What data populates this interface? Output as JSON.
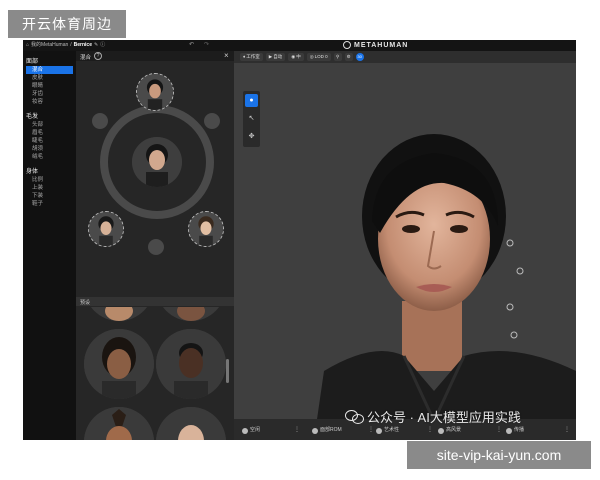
{
  "watermarks": {
    "top_left": "开云体育周边",
    "bottom_right": "site-vip-kai-yun.com",
    "wechat": "公众号 · AI大模型应用实践"
  },
  "titlebar": {
    "breadcrumb_home": "我的MetaHuman",
    "separator": "/",
    "breadcrumb_current": "Bernice",
    "brand": "METAHUMAN"
  },
  "nav": {
    "sections": [
      {
        "title": "面部",
        "items": [
          "混合",
          "皮肤",
          "眼睛",
          "牙齿",
          "妆容"
        ],
        "active_index": 0
      },
      {
        "title": "毛发",
        "items": [
          "头部",
          "眉毛",
          "睫毛",
          "胡须",
          "绒毛"
        ]
      },
      {
        "title": "身体",
        "items": [
          "比例",
          "上装",
          "下装",
          "鞋子"
        ]
      }
    ]
  },
  "panel": {
    "title": "混合",
    "help": "?",
    "close": "×",
    "presets_label": "预设"
  },
  "viewport": {
    "toolbar": {
      "camera": "工作室",
      "lod_auto": "自动",
      "quality": "中",
      "lod": "LOD 0",
      "badge": "30"
    },
    "bottom": {
      "item1": "空闲",
      "item2": "面部ROM",
      "item3": "艺术性",
      "item4": "高风景",
      "item5": "传播"
    }
  },
  "colors": {
    "accent": "#1a73e8",
    "app_bg": "#1e1e1e",
    "viewport_bg": "#3f3f3f"
  }
}
